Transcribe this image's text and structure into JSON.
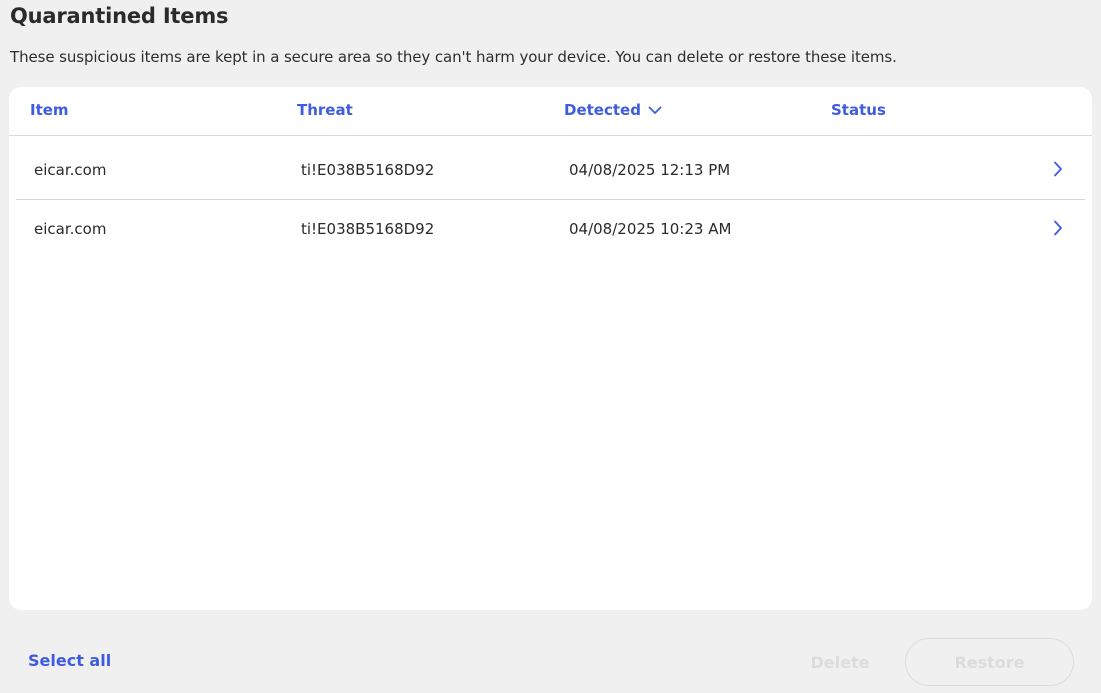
{
  "header": {
    "title": "Quarantined Items",
    "description": "These suspicious items are kept in a secure area so they can't harm your device. You can delete or restore these items."
  },
  "table": {
    "columns": [
      "Item",
      "Threat",
      "Detected",
      "Status"
    ],
    "sorted_column": "Detected",
    "sort_direction_icon": "chevron-down-icon",
    "rows": [
      {
        "item": "eicar.com",
        "threat": "ti!E038B5168D92",
        "detected": "04/08/2025 12:13 PM",
        "status": ""
      },
      {
        "item": "eicar.com",
        "threat": "ti!E038B5168D92",
        "detected": "04/08/2025 10:23 AM",
        "status": ""
      }
    ]
  },
  "footer": {
    "select_all_label": "Select all",
    "delete_label": "Delete",
    "restore_label": "Restore"
  },
  "colors": {
    "accent": "#3f5ce0",
    "background": "#f0f0f0",
    "card": "#ffffff",
    "disabled": "#dcdcdc"
  }
}
